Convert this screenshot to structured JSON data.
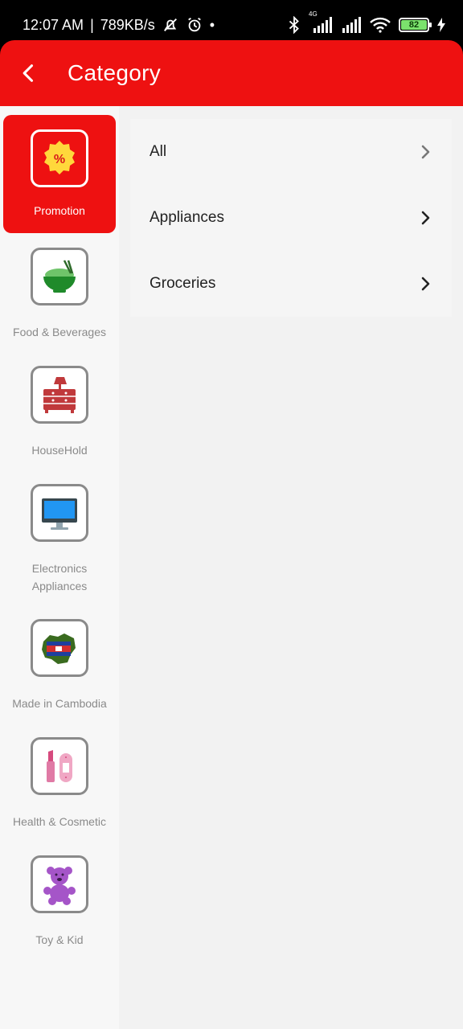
{
  "status_bar": {
    "time": "12:07 AM",
    "separator": "|",
    "speed": "789KB/s",
    "network_label": "4G",
    "battery": "82",
    "icons": [
      "muted-bell-icon",
      "alarm-icon",
      "bluetooth-icon",
      "signal-icon",
      "wifi-icon",
      "battery-icon",
      "charging-icon"
    ]
  },
  "header": {
    "title": "Category",
    "back_icon": "back-arrow-icon",
    "color": "#ee1111"
  },
  "sidebar": {
    "items": [
      {
        "label": "Promotion",
        "icon": "promotion-badge-icon",
        "active": true
      },
      {
        "label": "Food & Beverages",
        "icon": "rice-bowl-icon",
        "active": false
      },
      {
        "label": "HouseHold",
        "icon": "dresser-lamp-icon",
        "active": false
      },
      {
        "label": "Electronics Appliances",
        "icon": "monitor-icon",
        "active": false
      },
      {
        "label": "Made in Cambodia",
        "icon": "cambodia-map-icon",
        "active": false
      },
      {
        "label": "Health & Cosmetic",
        "icon": "lipstick-icon",
        "active": false
      },
      {
        "label": "Toy & Kid",
        "icon": "teddy-bear-icon",
        "active": false
      }
    ]
  },
  "subcategories": [
    {
      "label": "All",
      "icon": "chevron-right-icon"
    },
    {
      "label": "Appliances",
      "icon": "chevron-right-icon"
    },
    {
      "label": "Groceries",
      "icon": "chevron-right-icon"
    }
  ]
}
